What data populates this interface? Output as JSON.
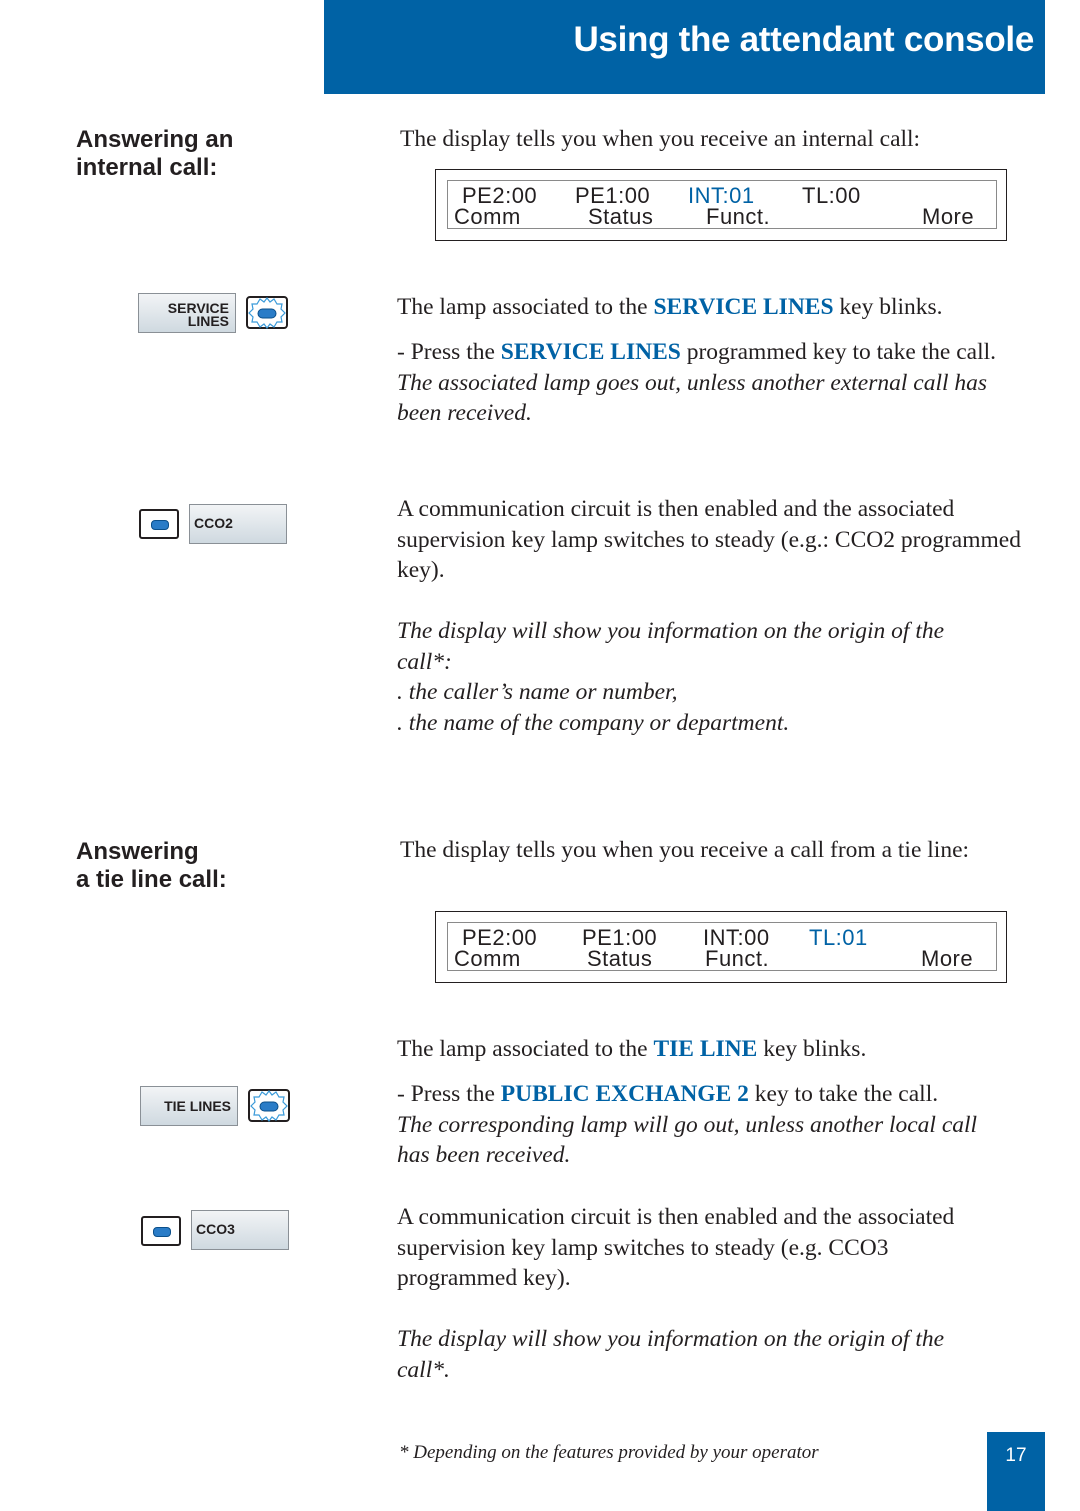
{
  "header": {
    "title": "Using the attendant console"
  },
  "section_internal": {
    "heading_line1": "Answering an",
    "heading_line2": "internal call:",
    "intro": "The display tells you when you receive an internal call:",
    "display": {
      "row1": [
        {
          "text": "PE2:00",
          "active": false
        },
        {
          "text": "PE1:00",
          "active": false
        },
        {
          "text": "INT:01",
          "active": true
        },
        {
          "text": "TL:00",
          "active": false
        }
      ],
      "row2": [
        "Comm",
        "Status",
        "Funct.",
        "More"
      ]
    },
    "lamp_text": {
      "pre": "The lamp associated to the ",
      "key": "SERVICE LINES",
      "post": " key blinks."
    },
    "press_text": {
      "pre": "- Press the ",
      "key": "SERVICE LINES",
      "post": " programmed key to take the call."
    },
    "result_lines": [
      "The associated lamp goes out, unless another external call has",
      "been received."
    ],
    "circuit_lines": [
      "A communication circuit is then enabled and the associated",
      "supervision key lamp switches to steady (e.g.: CCO2 programmed",
      "key)."
    ],
    "origin_lines": [
      "The display will show you information on the origin of the",
      "call*:",
      ". the caller’s name or number,",
      ". the name of the company or department."
    ],
    "keys": {
      "service_line1": "SERVICE",
      "service_line2": "LINES",
      "cco": "CCO2"
    }
  },
  "section_tie": {
    "heading_line1": "Answering",
    "heading_line2": "a tie line call:",
    "intro": "The display tells you when you receive a call from a tie line:",
    "display": {
      "row1": [
        {
          "text": "PE2:00",
          "active": false
        },
        {
          "text": "PE1:00",
          "active": false
        },
        {
          "text": "INT:00",
          "active": false
        },
        {
          "text": "TL:01",
          "active": true
        }
      ],
      "row2": [
        "Comm",
        "Status",
        "Funct.",
        "More"
      ]
    },
    "lamp_text": {
      "pre": "The lamp associated to the ",
      "key": "TIE LINE",
      "post": " key blinks."
    },
    "press_text": {
      "pre": "- Press the ",
      "key": "PUBLIC EXCHANGE 2",
      "post": " key to take the call."
    },
    "result_lines": [
      "The corresponding lamp will go out, unless another local call",
      "has been received."
    ],
    "circuit_lines": [
      "A communication circuit is then enabled and the associated",
      "supervision key lamp switches to steady (e.g. CCO3",
      "programmed key)."
    ],
    "origin_lines": [
      "The display will show you information on the origin of the",
      "call*."
    ],
    "keys": {
      "tie": "TIE LINES",
      "cco": "CCO3"
    }
  },
  "footnote": "* Depending on the features provided by your operator",
  "page_number": "17",
  "colors": {
    "brand_blue": "#0062a5",
    "text": "#231f20"
  }
}
